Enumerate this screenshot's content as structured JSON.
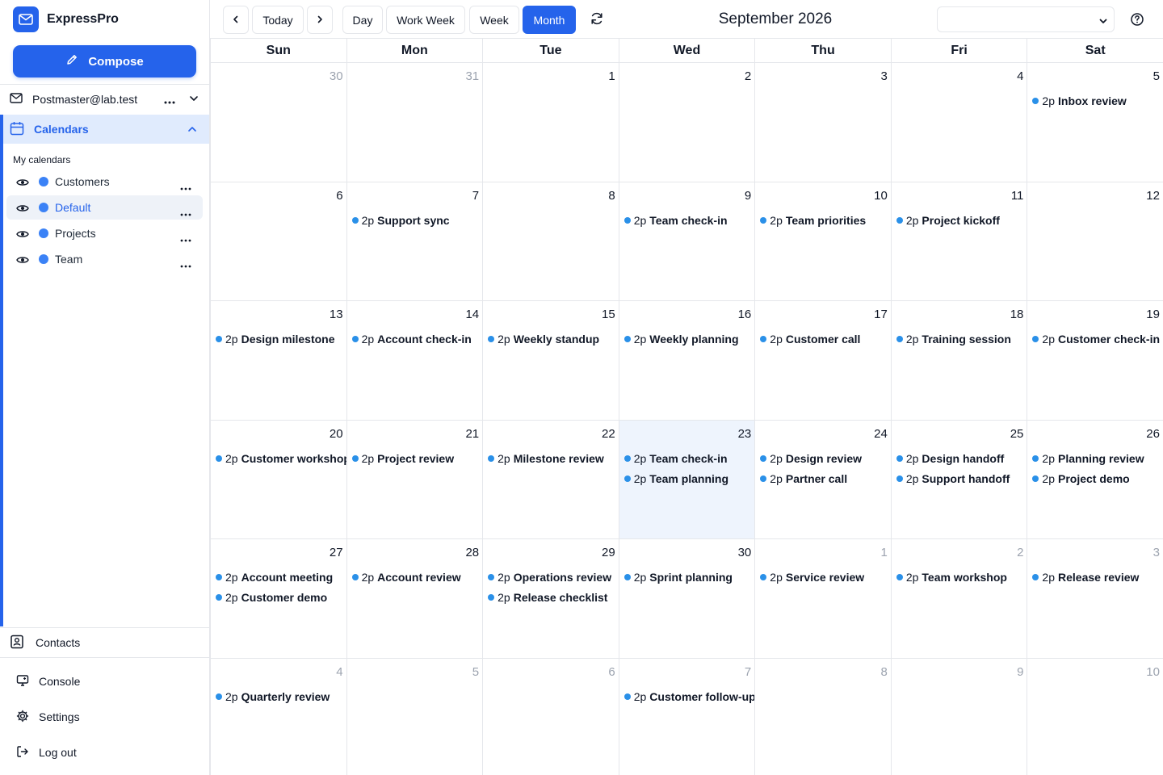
{
  "app": {
    "name": "ExpressPro"
  },
  "sidebar": {
    "compose_label": "Compose",
    "account": "Postmaster@lab.test",
    "calendars_label": "Calendars",
    "my_calendars_title": "My calendars",
    "calendars": [
      {
        "label": "Customers",
        "color": "#3b82f6",
        "active": false
      },
      {
        "label": "Default",
        "color": "#3b82f6",
        "active": true
      },
      {
        "label": "Projects",
        "color": "#3b82f6",
        "active": false
      },
      {
        "label": "Team",
        "color": "#3b82f6",
        "active": false
      }
    ],
    "contacts_label": "Contacts",
    "console_label": "Console",
    "settings_label": "Settings",
    "logout_label": "Log out"
  },
  "toolbar": {
    "today_label": "Today",
    "views": [
      "Day",
      "Work Week",
      "Week",
      "Month"
    ],
    "active_view": "Month",
    "title": "September 2026",
    "calendar_select_value": ""
  },
  "calendar": {
    "weekdays": [
      "Sun",
      "Mon",
      "Tue",
      "Wed",
      "Thu",
      "Fri",
      "Sat"
    ],
    "today": "23",
    "accent_color": "#2563eb",
    "event_dot_color": "#2a90e8",
    "weeks": [
      [
        {
          "day": "30",
          "other": true,
          "events": []
        },
        {
          "day": "31",
          "other": true,
          "events": []
        },
        {
          "day": "1",
          "other": false,
          "events": []
        },
        {
          "day": "2",
          "other": false,
          "events": []
        },
        {
          "day": "3",
          "other": false,
          "events": []
        },
        {
          "day": "4",
          "other": false,
          "events": []
        },
        {
          "day": "5",
          "other": false,
          "events": [
            {
              "time": "2p",
              "title": "Inbox review"
            }
          ]
        }
      ],
      [
        {
          "day": "6",
          "other": false,
          "events": []
        },
        {
          "day": "7",
          "other": false,
          "events": [
            {
              "time": "2p",
              "title": "Support sync"
            }
          ]
        },
        {
          "day": "8",
          "other": false,
          "events": []
        },
        {
          "day": "9",
          "other": false,
          "events": [
            {
              "time": "2p",
              "title": "Team check-in"
            }
          ]
        },
        {
          "day": "10",
          "other": false,
          "events": [
            {
              "time": "2p",
              "title": "Team priorities"
            }
          ]
        },
        {
          "day": "11",
          "other": false,
          "events": [
            {
              "time": "2p",
              "title": "Project kickoff"
            }
          ]
        },
        {
          "day": "12",
          "other": false,
          "events": []
        }
      ],
      [
        {
          "day": "13",
          "other": false,
          "events": [
            {
              "time": "2p",
              "title": "Design milestone"
            }
          ]
        },
        {
          "day": "14",
          "other": false,
          "events": [
            {
              "time": "2p",
              "title": "Account check-in"
            }
          ]
        },
        {
          "day": "15",
          "other": false,
          "events": [
            {
              "time": "2p",
              "title": "Weekly standup"
            }
          ]
        },
        {
          "day": "16",
          "other": false,
          "events": [
            {
              "time": "2p",
              "title": "Weekly planning"
            }
          ]
        },
        {
          "day": "17",
          "other": false,
          "events": [
            {
              "time": "2p",
              "title": "Customer call"
            }
          ]
        },
        {
          "day": "18",
          "other": false,
          "events": [
            {
              "time": "2p",
              "title": "Training session"
            }
          ]
        },
        {
          "day": "19",
          "other": false,
          "events": [
            {
              "time": "2p",
              "title": "Customer check-in"
            }
          ]
        }
      ],
      [
        {
          "day": "20",
          "other": false,
          "events": [
            {
              "time": "2p",
              "title": "Customer workshop"
            }
          ]
        },
        {
          "day": "21",
          "other": false,
          "events": [
            {
              "time": "2p",
              "title": "Project review"
            }
          ]
        },
        {
          "day": "22",
          "other": false,
          "events": [
            {
              "time": "2p",
              "title": "Milestone review"
            }
          ]
        },
        {
          "day": "23",
          "other": false,
          "events": [
            {
              "time": "2p",
              "title": "Team check-in"
            },
            {
              "time": "2p",
              "title": "Team planning"
            }
          ]
        },
        {
          "day": "24",
          "other": false,
          "events": [
            {
              "time": "2p",
              "title": "Design review"
            },
            {
              "time": "2p",
              "title": "Partner call"
            }
          ]
        },
        {
          "day": "25",
          "other": false,
          "events": [
            {
              "time": "2p",
              "title": "Design handoff"
            },
            {
              "time": "2p",
              "title": "Support handoff"
            }
          ]
        },
        {
          "day": "26",
          "other": false,
          "events": [
            {
              "time": "2p",
              "title": "Planning review"
            },
            {
              "time": "2p",
              "title": "Project demo"
            }
          ]
        }
      ],
      [
        {
          "day": "27",
          "other": false,
          "events": [
            {
              "time": "2p",
              "title": "Account meeting"
            },
            {
              "time": "2p",
              "title": "Customer demo"
            }
          ]
        },
        {
          "day": "28",
          "other": false,
          "events": [
            {
              "time": "2p",
              "title": "Account review"
            }
          ]
        },
        {
          "day": "29",
          "other": false,
          "events": [
            {
              "time": "2p",
              "title": "Operations review"
            },
            {
              "time": "2p",
              "title": "Release checklist"
            }
          ]
        },
        {
          "day": "30",
          "other": false,
          "events": [
            {
              "time": "2p",
              "title": "Sprint planning"
            }
          ]
        },
        {
          "day": "1",
          "other": true,
          "events": [
            {
              "time": "2p",
              "title": "Service review"
            }
          ]
        },
        {
          "day": "2",
          "other": true,
          "events": [
            {
              "time": "2p",
              "title": "Team workshop"
            }
          ]
        },
        {
          "day": "3",
          "other": true,
          "events": [
            {
              "time": "2p",
              "title": "Release review"
            }
          ]
        }
      ],
      [
        {
          "day": "4",
          "other": true,
          "events": [
            {
              "time": "2p",
              "title": "Quarterly review"
            }
          ]
        },
        {
          "day": "5",
          "other": true,
          "events": []
        },
        {
          "day": "6",
          "other": true,
          "events": []
        },
        {
          "day": "7",
          "other": true,
          "events": [
            {
              "time": "2p",
              "title": "Customer follow-up"
            }
          ]
        },
        {
          "day": "8",
          "other": true,
          "events": []
        },
        {
          "day": "9",
          "other": true,
          "events": []
        },
        {
          "day": "10",
          "other": true,
          "events": []
        }
      ]
    ]
  }
}
